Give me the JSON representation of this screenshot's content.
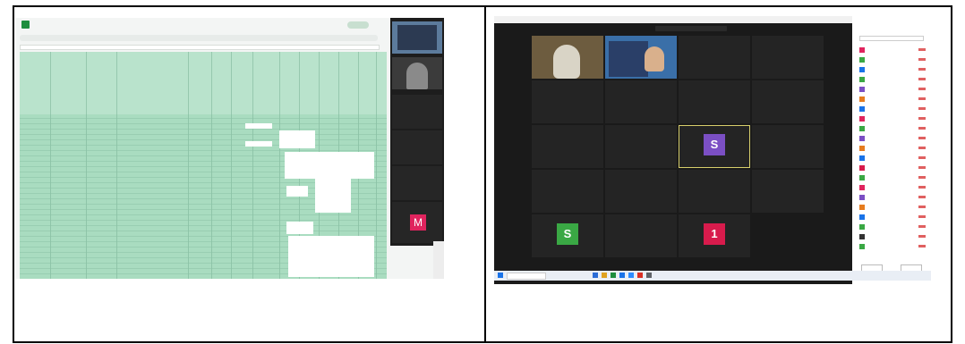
{
  "left": {
    "sheet_title": "",
    "menu_items": [
      "",
      "",
      "",
      "",
      "",
      ""
    ],
    "meeting_tiles": [
      "",
      "",
      "",
      ""
    ],
    "avatar_letter": "M"
  },
  "right": {
    "window_title": "",
    "header": "",
    "tiles": [
      {
        "name": "",
        "sub": "",
        "kind": "video1"
      },
      {
        "name": "",
        "sub": "",
        "kind": "video2"
      },
      {
        "name": "",
        "sub": "",
        "kind": "text"
      },
      {
        "name": "",
        "sub": "",
        "kind": "text"
      },
      {
        "name": "",
        "sub": "",
        "kind": "text"
      },
      {
        "name": "",
        "sub": "",
        "kind": "text"
      },
      {
        "name": "",
        "sub": "",
        "kind": "text"
      },
      {
        "name": "",
        "sub": "",
        "kind": "text"
      },
      {
        "name": "",
        "sub": "",
        "kind": "text"
      },
      {
        "name": "",
        "sub": "",
        "kind": "text"
      },
      {
        "name": "",
        "sub": "",
        "kind": "avatar",
        "letter": "S",
        "color": "#7b4fc4",
        "highlight": true
      },
      {
        "name": "",
        "sub": "",
        "kind": "text"
      },
      {
        "name": "",
        "sub": "",
        "kind": "text"
      },
      {
        "name": "",
        "sub": "",
        "kind": "text"
      },
      {
        "name": "",
        "sub": "",
        "kind": "text"
      },
      {
        "name": "",
        "sub": "",
        "kind": "text"
      },
      {
        "name": "",
        "sub": "",
        "kind": "avatar",
        "letter": "S",
        "color": "#3aa844"
      },
      {
        "name": "",
        "sub": "",
        "kind": "text"
      },
      {
        "name": "",
        "sub": "",
        "kind": "avatar",
        "letter": "1",
        "color": "#d81b4c"
      }
    ],
    "panel_title": "",
    "search_placeholder": "",
    "participants": [
      {
        "name": "",
        "color": "#e0245e"
      },
      {
        "name": "",
        "color": "#3aa844"
      },
      {
        "name": "",
        "color": "#1a73e8"
      },
      {
        "name": "",
        "color": "#3aa844"
      },
      {
        "name": "",
        "color": "#7b4fc4"
      },
      {
        "name": "",
        "color": "#e67c1f"
      },
      {
        "name": "",
        "color": "#1a73e8"
      },
      {
        "name": "",
        "color": "#e0245e"
      },
      {
        "name": "",
        "color": "#3aa844"
      },
      {
        "name": "",
        "color": "#7b4fc4"
      },
      {
        "name": "",
        "color": "#e67c1f"
      },
      {
        "name": "",
        "color": "#1a73e8"
      },
      {
        "name": "",
        "color": "#d81b4c"
      },
      {
        "name": "",
        "color": "#3aa844"
      },
      {
        "name": "",
        "color": "#e0245e"
      },
      {
        "name": "",
        "color": "#7b4fc4"
      },
      {
        "name": "",
        "color": "#e67c1f"
      },
      {
        "name": "",
        "color": "#1a73e8"
      },
      {
        "name": "",
        "color": "#3aa844"
      },
      {
        "name": "",
        "color": "#333333"
      },
      {
        "name": "",
        "color": "#3aa844"
      }
    ],
    "footer_buttons": [
      "",
      ""
    ],
    "taskbar": {
      "search": "",
      "clock": ""
    }
  }
}
